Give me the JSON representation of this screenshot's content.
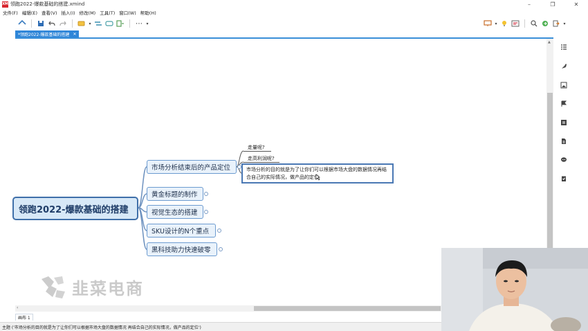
{
  "window": {
    "logo": "XM",
    "title": "领跑2022-爆款基础的搭建.xmind",
    "controls": [
      "–",
      "❐",
      "✕"
    ]
  },
  "menu": [
    "文件(F)",
    "编辑(E)",
    "查看(V)",
    "插入(I)",
    "修改(M)",
    "工具(T)",
    "窗口(W)",
    "帮助(H)"
  ],
  "toolbar": {
    "left_icons": [
      "home-icon",
      "save-icon",
      "undo-icon",
      "redo-icon",
      "topic-style-icon",
      "relationship-icon",
      "boundary-icon",
      "summary-icon",
      "more-icon"
    ],
    "right_icons": [
      "presentation-icon",
      "idea-icon",
      "outline-view-icon",
      "search-icon",
      "share-icon",
      "export-icon"
    ]
  },
  "tabs": [
    {
      "label": "*领跑2022-爆款基础的搭建",
      "close": "✕"
    }
  ],
  "mindmap": {
    "central": "领跑2022-爆款基础的搭建",
    "topics": [
      {
        "label": "市场分析结束后的产品定位"
      },
      {
        "label": "黄金标题的制作"
      },
      {
        "label": "视觉生态的搭建"
      },
      {
        "label": "SKU设计的N个重点"
      },
      {
        "label": "黑科技助力快速破零"
      }
    ],
    "subtopics": [
      "走量呢?",
      "走高利润呢?"
    ],
    "note": "市场分析的目的就是为了让你们可以根据市场大盘的数据情况再结合自己的实际情况，做产品的定位"
  },
  "sidebar_icons": [
    "outline-icon",
    "format-icon",
    "image-icon",
    "marker-icon",
    "notes-icon",
    "document-icon",
    "comments-icon",
    "task-icon"
  ],
  "watermark": {
    "text": "韭菜电商"
  },
  "sheet": {
    "label": "画布 1"
  },
  "status": {
    "text": "主题 ('市场分析的目的就是为了让你们可以根据市场大盘的数据情况 再结合自己的实际情况，做产品的定位')"
  },
  "colors": {
    "accent": "#3a8fd8",
    "central_border": "#3f6fa9",
    "topic_fill": "#e9f2fb",
    "logo_red": "#d8262e"
  }
}
